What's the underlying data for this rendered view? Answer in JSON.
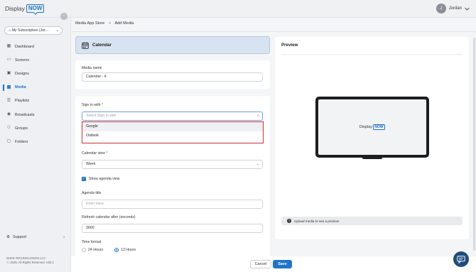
{
  "header": {
    "logo_display": "Display",
    "logo_now": "NOW",
    "collapse_icon": "chevron-left-icon",
    "user_initial": "J",
    "user_name": "Jordan"
  },
  "sidebar": {
    "subscription": "My Subscription (Jor...",
    "items": [
      {
        "label": "Dashboard",
        "icon": "dashboard-icon"
      },
      {
        "label": "Screens",
        "icon": "screens-icon"
      },
      {
        "label": "Designs",
        "icon": "designs-icon"
      },
      {
        "label": "Media",
        "icon": "media-icon",
        "active": true
      },
      {
        "label": "Playlists",
        "icon": "playlists-icon"
      },
      {
        "label": "Broadcasts",
        "icon": "broadcasts-icon"
      },
      {
        "label": "Groups",
        "icon": "groups-icon"
      },
      {
        "label": "Folders",
        "icon": "folders-icon"
      }
    ],
    "support": "Support",
    "footer_company": "DUKE TECHNOLOGIES LLC",
    "footer_rights": "ⓒ 2025. All Rights Reserved. V25.1"
  },
  "breadcrumb": {
    "parent": "Media App Store",
    "separator": ">",
    "current": "Add Media"
  },
  "form": {
    "app_title": "Calendar",
    "media_name_label": "Media name",
    "media_name_value": "Calendar - 4",
    "sign_in_label": "Sign in with",
    "required_mark": "*",
    "sign_in_placeholder": "Select Sign in with",
    "sign_in_options": [
      "Google",
      "Outlook"
    ],
    "calendar_view_label": "Calendar view",
    "calendar_view_value": "Week",
    "show_agenda_label": "Show agenda view",
    "show_agenda_checked": true,
    "agenda_title_label": "Agenda title",
    "agenda_title_placeholder": "Enter Here",
    "refresh_label": "Refresh calendar after (seconds)",
    "refresh_value": "3600",
    "time_format_label": "Time format",
    "time_format_options": [
      "24 Hours",
      "12 Hours"
    ],
    "time_format_selected": "12 Hours"
  },
  "preview": {
    "title": "Preview",
    "logo_display": "Display",
    "logo_now": "NOW",
    "upload_message": "Upload media to see a preview"
  },
  "actions": {
    "cancel": "Cancel",
    "save": "Save"
  },
  "colors": {
    "accent": "#1f73c9",
    "highlight": "#d32f2f"
  }
}
